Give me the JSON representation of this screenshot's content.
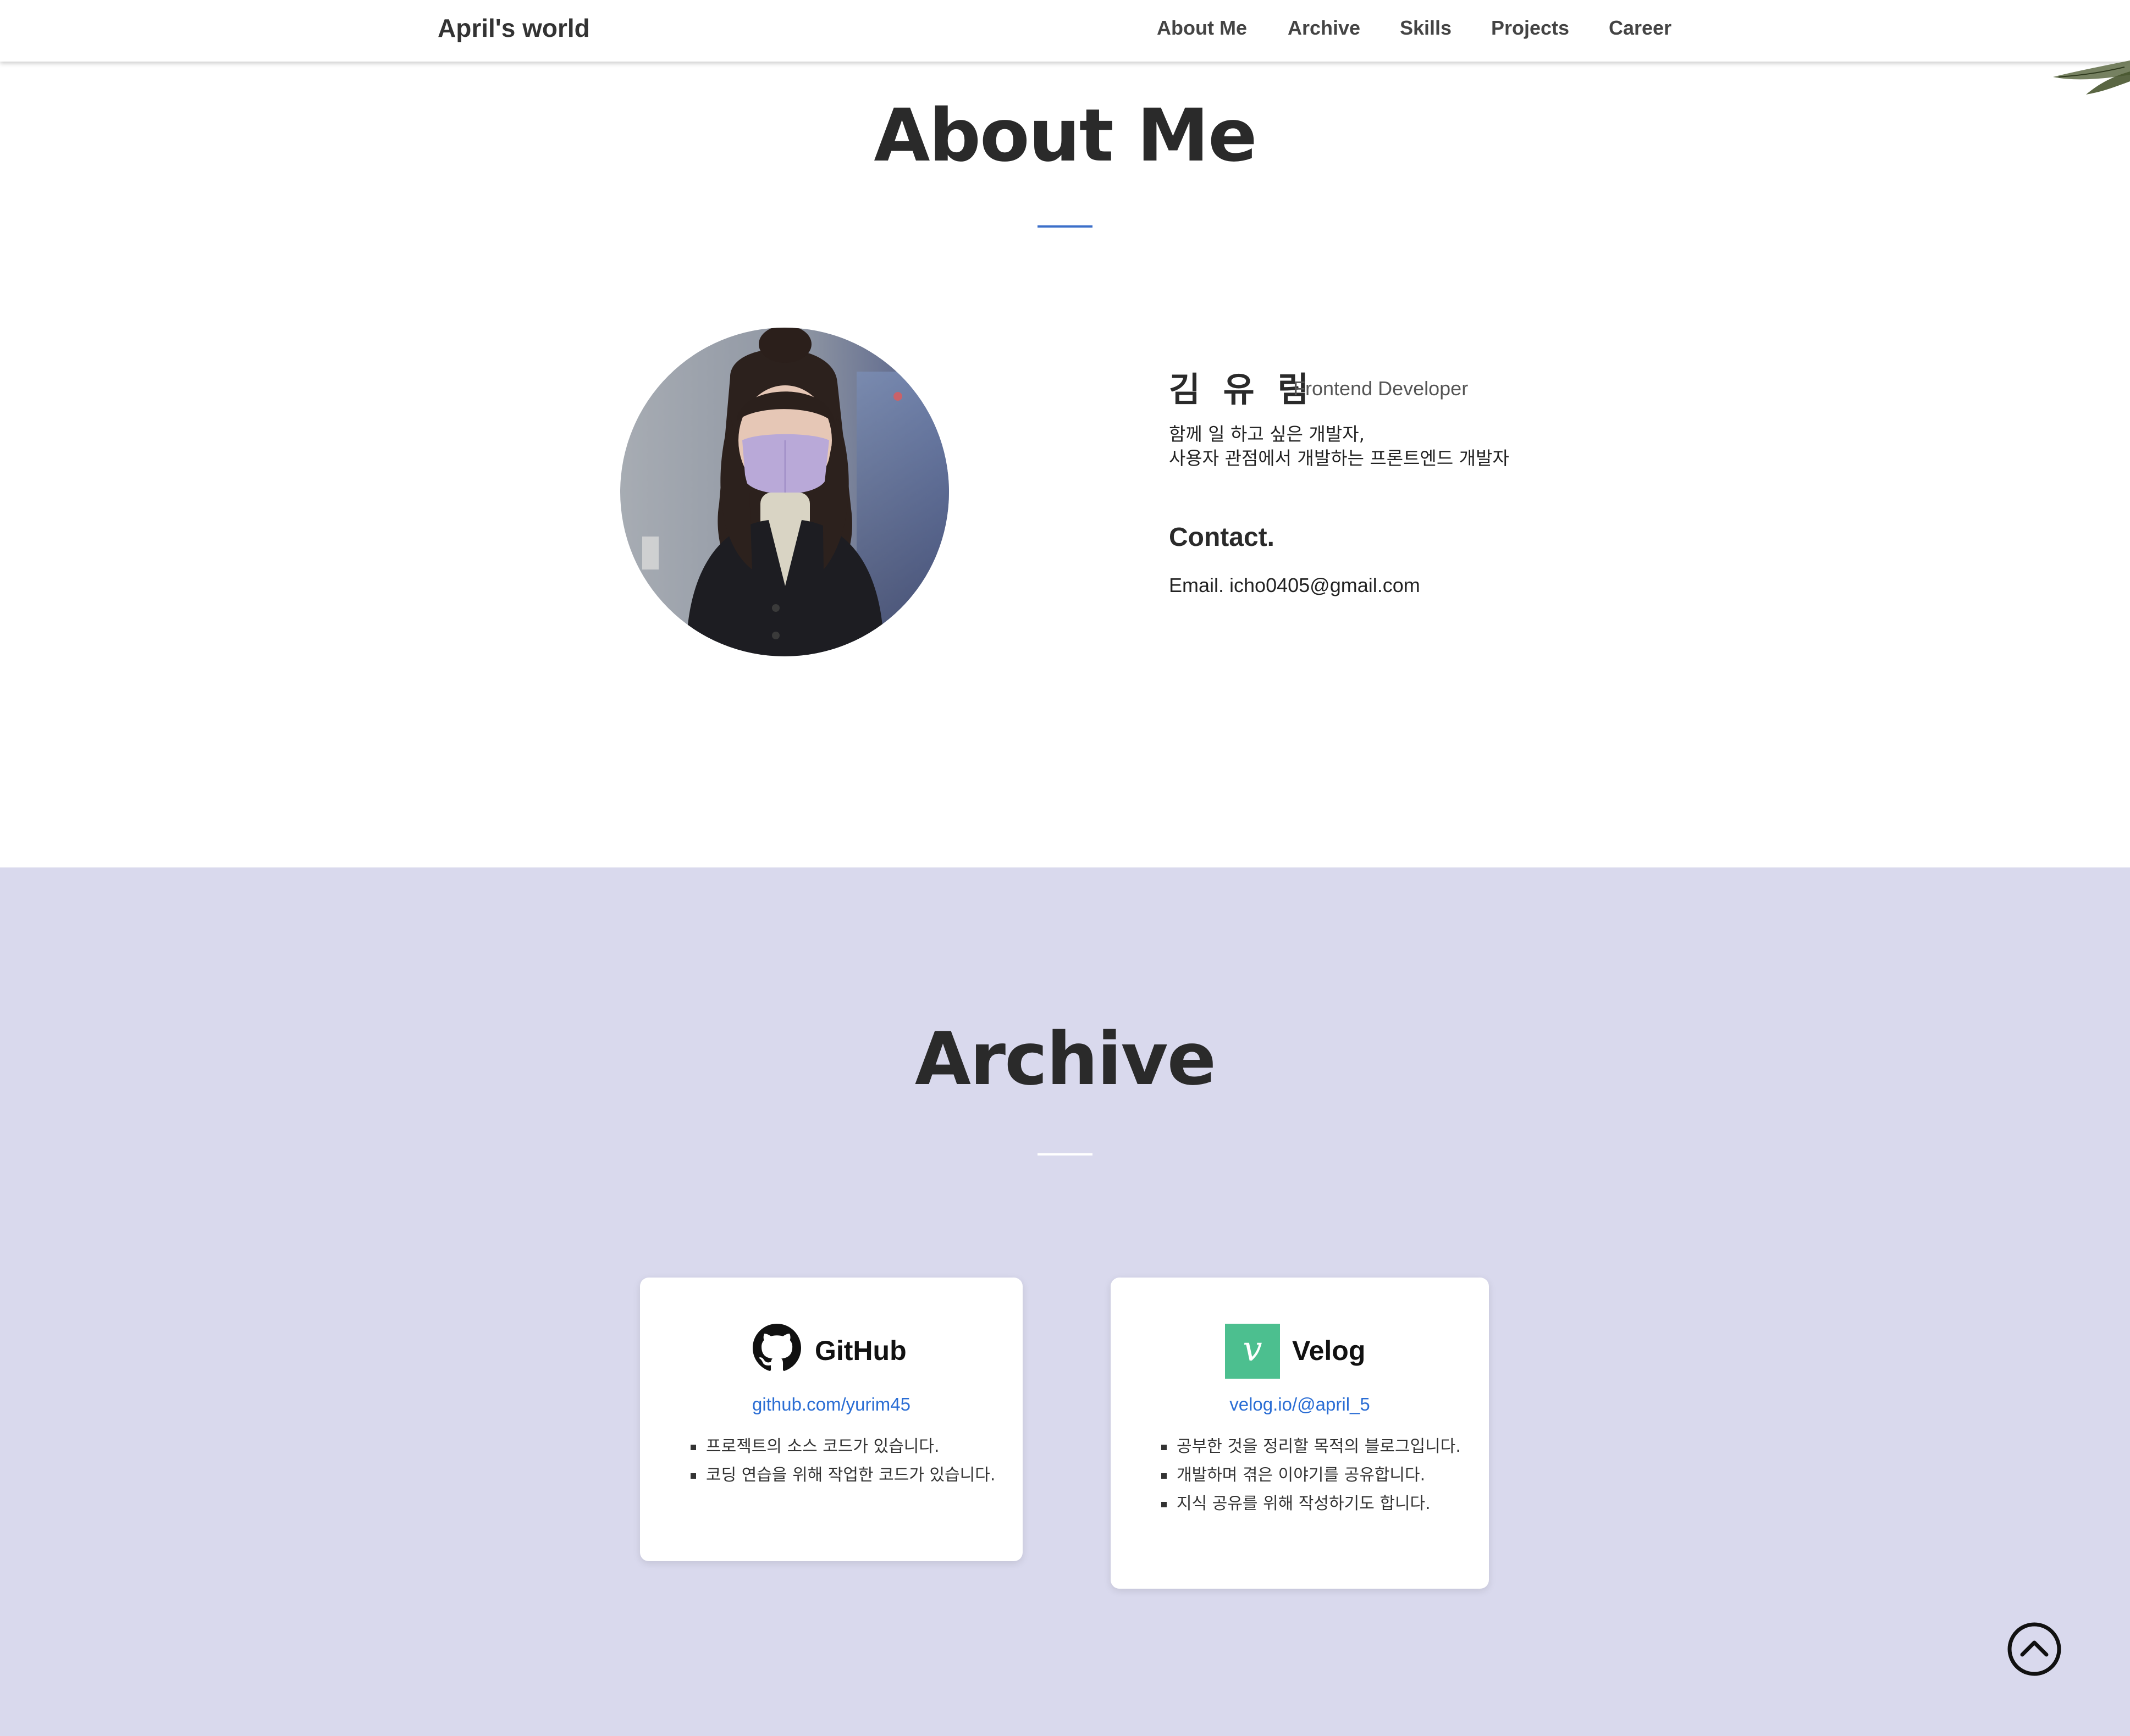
{
  "header": {
    "brand": "April's world",
    "nav": [
      "About Me",
      "Archive",
      "Skills",
      "Projects",
      "Career"
    ]
  },
  "about": {
    "title": "About Me",
    "name": "김 유 림",
    "role": "Frontend Developer",
    "desc_line1": "함께 일 하고 싶은 개발자,",
    "desc_line2": "사용자 관점에서 개발하는 프론트엔드 개발자",
    "contact_title": "Contact.",
    "email": "Email. icho0405@gmail.com"
  },
  "archive": {
    "title": "Archive",
    "cards": [
      {
        "name": "GitHub",
        "link": "github.com/yurim45",
        "items": [
          "프로젝트의 소스 코드가 있습니다.",
          "코딩 연습을 위해 작업한 코드가 있습니다."
        ]
      },
      {
        "name": "Velog",
        "logo_letter": "v",
        "link": "velog.io/@april_5",
        "items": [
          "공부한 것을 정리할 목적의 블로그입니다.",
          "개발하며 겪은 이야기를 공유합니다.",
          "지식 공유를 위해 작성하기도 합니다."
        ]
      }
    ]
  },
  "colors": {
    "archive_bg": "#d9d9ed",
    "accent_underline": "#3c6fc9",
    "link": "#2a6dd4",
    "velog_green": "#4cbf8f"
  },
  "icons": {
    "github": "github-icon",
    "velog": "velog-logo-icon",
    "scroll_top": "chevron-up-circle-icon"
  }
}
